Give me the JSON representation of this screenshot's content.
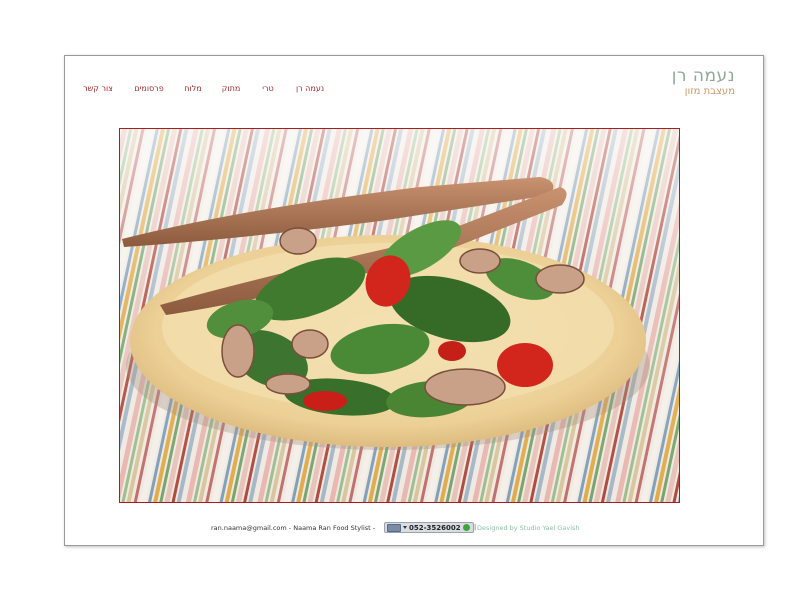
{
  "logo": {
    "name": "נעמה רן",
    "subtitle": "מעצבת מזון"
  },
  "nav": [
    {
      "label": "צור קשר"
    },
    {
      "label": "פרסומים"
    },
    {
      "label": "מלוח"
    },
    {
      "label": "מתוק"
    },
    {
      "label": "טרי"
    },
    {
      "label": "נעמה רן"
    }
  ],
  "photo": {
    "alt_icon": "salad-photo"
  },
  "footer": {
    "email_text": "ran.naama@gmail.com - Naama Ran Food Stylist -",
    "phone": "052-3526002",
    "separator": "|",
    "credit": "Designed by Studio Yael Gavish"
  },
  "colors": {
    "accent": "#a6282a",
    "logo": "#8fa89b",
    "logo_sub": "#c89a64",
    "credit": "#8ec0a8"
  }
}
